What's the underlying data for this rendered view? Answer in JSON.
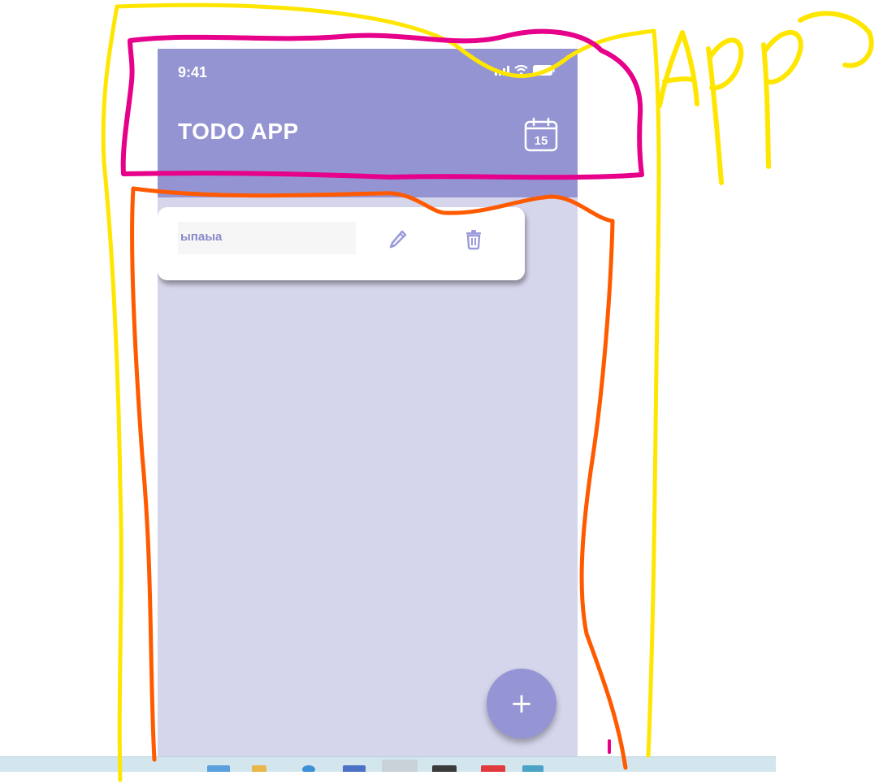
{
  "status_bar": {
    "time": "9:41",
    "signal_icon": "signal-icon",
    "wifi_icon": "wifi-icon",
    "battery_icon": "battery-icon"
  },
  "header": {
    "title": "TODO APP",
    "calendar_icon": "calendar-icon",
    "calendar_day": "15"
  },
  "todos": [
    {
      "text": "ыпаыа",
      "edit_icon": "pencil-icon",
      "delete_icon": "trash-icon"
    }
  ],
  "fab": {
    "label": "+",
    "icon": "plus-icon"
  },
  "annotations": {
    "handwritten_label": "App"
  },
  "colors": {
    "header": "#9494d3",
    "background": "#d5d5ec",
    "accent": "#8a8acc",
    "fab": "#9595d5",
    "annotation_yellow": "#ffe600",
    "annotation_magenta": "#e6008a",
    "annotation_orange": "#ff5a00"
  }
}
